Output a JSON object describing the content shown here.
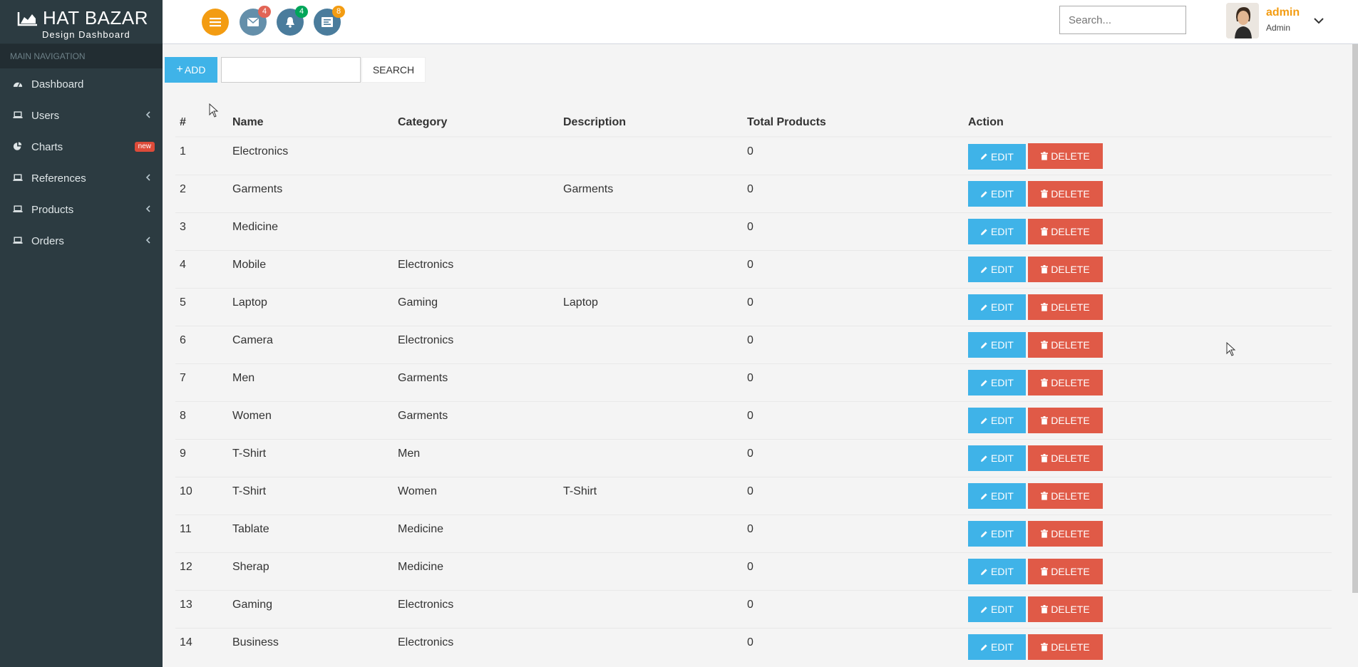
{
  "brand": {
    "title": "HAT BAZAR",
    "subtitle": "Design Dashboard"
  },
  "sidebar": {
    "header": "MAIN NAVIGATION",
    "items": [
      {
        "label": "Dashboard",
        "icon": "dashboard-icon"
      },
      {
        "label": "Users",
        "icon": "laptop-icon",
        "has_chevron": true
      },
      {
        "label": "Charts",
        "icon": "pie-chart-icon",
        "badge": "new"
      },
      {
        "label": "References",
        "icon": "laptop-icon",
        "has_chevron": true
      },
      {
        "label": "Products",
        "icon": "laptop-icon",
        "has_chevron": true
      },
      {
        "label": "Orders",
        "icon": "laptop-icon",
        "has_chevron": true
      }
    ]
  },
  "topbar": {
    "mail_count": "4",
    "notification_count": "4",
    "task_count": "8",
    "search_placeholder": "Search...",
    "user_name": "admin",
    "user_role": "Admin"
  },
  "toolbar": {
    "add_label": "ADD",
    "search_label": "SEARCH",
    "search_value": ""
  },
  "table": {
    "headers": [
      "#",
      "Name",
      "Category",
      "Description",
      "Total Products",
      "Action"
    ],
    "edit_label": "EDIT",
    "delete_label": "DELETE",
    "rows": [
      {
        "id": "1",
        "name": "Electronics",
        "category": "",
        "description": "",
        "total": "0"
      },
      {
        "id": "2",
        "name": "Garments",
        "category": "",
        "description": "Garments",
        "total": "0"
      },
      {
        "id": "3",
        "name": "Medicine",
        "category": "",
        "description": "",
        "total": "0"
      },
      {
        "id": "4",
        "name": "Mobile",
        "category": "Electronics",
        "description": "",
        "total": "0"
      },
      {
        "id": "5",
        "name": "Laptop",
        "category": "Gaming",
        "description": "Laptop",
        "total": "0"
      },
      {
        "id": "6",
        "name": "Camera",
        "category": "Electronics",
        "description": "",
        "total": "0"
      },
      {
        "id": "7",
        "name": "Men",
        "category": "Garments",
        "description": "",
        "total": "0"
      },
      {
        "id": "8",
        "name": "Women",
        "category": "Garments",
        "description": "",
        "total": "0"
      },
      {
        "id": "9",
        "name": "T-Shirt",
        "category": "Men",
        "description": "",
        "total": "0"
      },
      {
        "id": "10",
        "name": "T-Shirt",
        "category": "Women",
        "description": "T-Shirt",
        "total": "0"
      },
      {
        "id": "11",
        "name": "Tablate",
        "category": "Medicine",
        "description": "",
        "total": "0"
      },
      {
        "id": "12",
        "name": "Sherap",
        "category": "Medicine",
        "description": "",
        "total": "0"
      },
      {
        "id": "13",
        "name": "Gaming",
        "category": "Electronics",
        "description": "",
        "total": "0"
      },
      {
        "id": "14",
        "name": "Business",
        "category": "Electronics",
        "description": "",
        "total": "0"
      }
    ]
  },
  "colors": {
    "sidebar_bg": "#2c3b41",
    "accent_blue": "#3fb3e8",
    "danger": "#e05a47",
    "warning": "#f39c12"
  }
}
